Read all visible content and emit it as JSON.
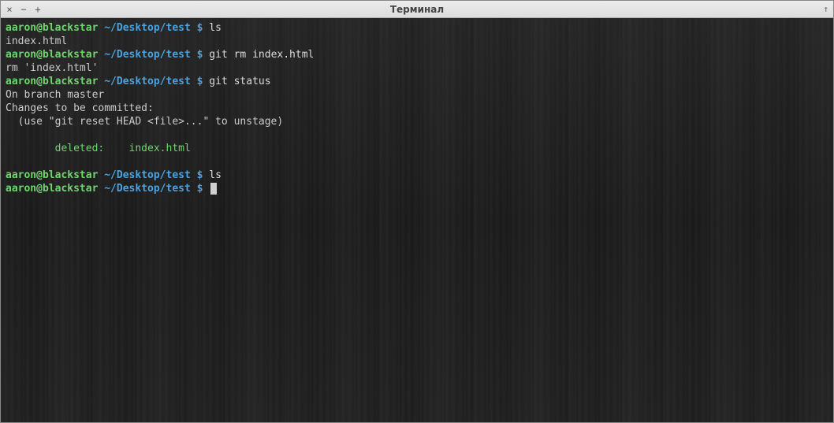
{
  "window": {
    "title": "Терминал",
    "close_glyph": "×",
    "minimize_glyph": "−",
    "maximize_glyph": "+",
    "menu_glyph": "↑"
  },
  "prompt": {
    "user": "aaron@blackstar",
    "path": "~/Desktop/test",
    "symbol": "$"
  },
  "lines": [
    {
      "type": "prompt",
      "cmd": "ls"
    },
    {
      "type": "output",
      "text": "index.html"
    },
    {
      "type": "prompt",
      "cmd": "git rm index.html"
    },
    {
      "type": "output",
      "text": "rm 'index.html'"
    },
    {
      "type": "prompt",
      "cmd": "git status"
    },
    {
      "type": "output",
      "text": "On branch master"
    },
    {
      "type": "output",
      "text": "Changes to be committed:"
    },
    {
      "type": "output",
      "text": "  (use \"git reset HEAD <file>...\" to unstage)"
    },
    {
      "type": "blank"
    },
    {
      "type": "git-green",
      "text": "        deleted:    index.html"
    },
    {
      "type": "blank"
    },
    {
      "type": "prompt",
      "cmd": "ls"
    },
    {
      "type": "prompt-cursor",
      "cmd": ""
    }
  ]
}
